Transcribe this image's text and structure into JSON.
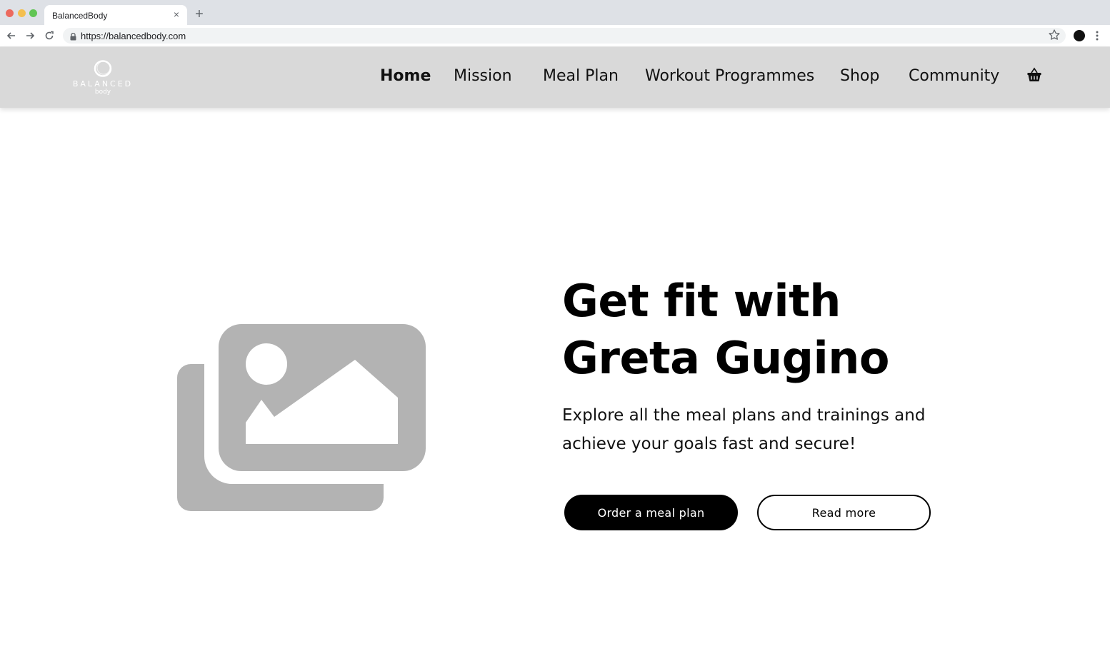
{
  "browser": {
    "tab_title": "BalancedBody",
    "url": "https://balancedbody.com",
    "close_glyph": "×",
    "new_tab_glyph": "+"
  },
  "logo": {
    "word": "BALANCED",
    "sub": "body"
  },
  "nav": {
    "items": [
      {
        "label": "Home",
        "active": true
      },
      {
        "label": "Mission"
      },
      {
        "label": "Meal Plan"
      },
      {
        "label": "Workout Programmes"
      },
      {
        "label": "Shop"
      },
      {
        "label": "Community"
      }
    ],
    "cart_icon": "basket-icon"
  },
  "hero": {
    "title_line1": "Get fit with",
    "title_line2": "Greta Gugino",
    "subtitle_line1": "Explore all the meal plans and trainings and",
    "subtitle_line2": "achieve your goals fast and secure!",
    "primary_button": "Order a meal plan",
    "secondary_button": "Read more",
    "image_icon": "image-placeholder-icon"
  },
  "colors": {
    "header_bg": "#d9d9d9",
    "placeholder_gray": "#b3b3b3",
    "primary": "#000000"
  }
}
